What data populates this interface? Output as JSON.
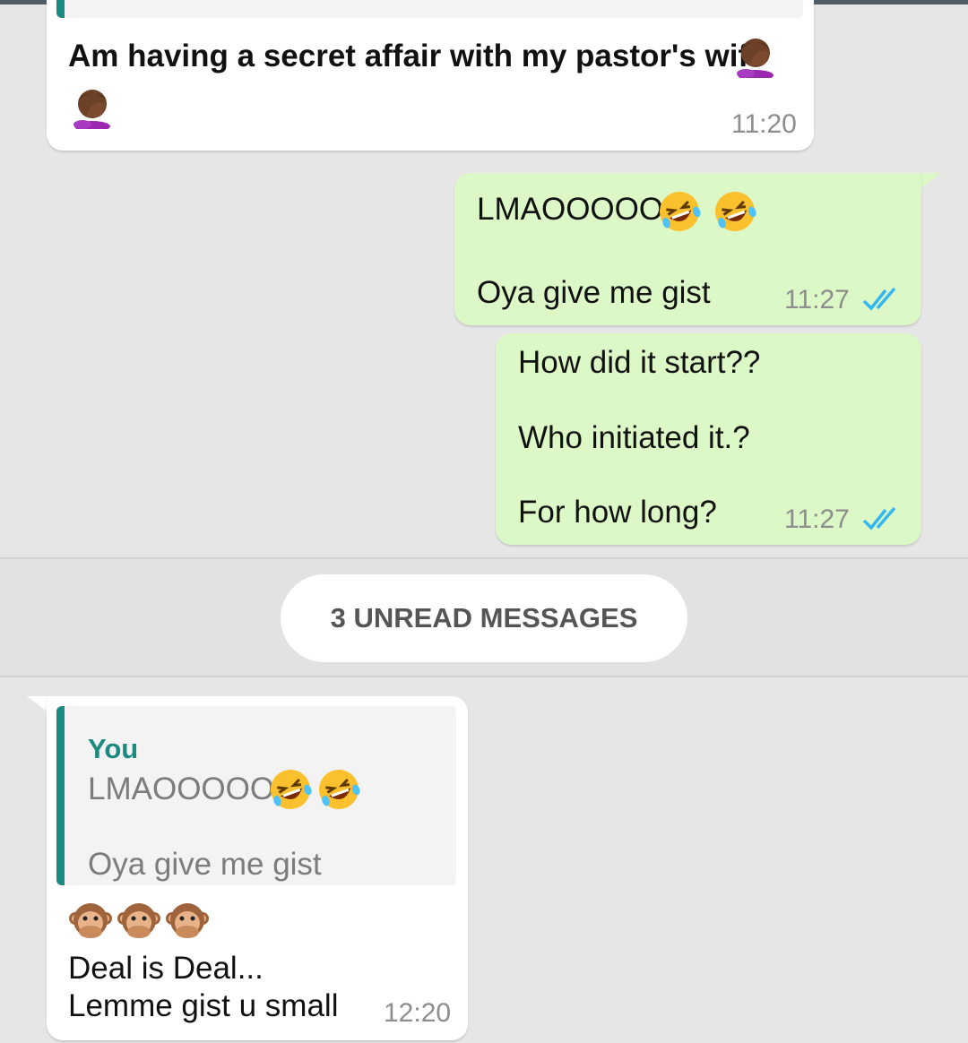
{
  "messages": [
    {
      "id": "m1",
      "direction": "incoming",
      "text": "Am having a secret affair with my pastor's wife",
      "time": "11:20"
    },
    {
      "id": "m2",
      "direction": "outgoing",
      "line1": "LMAOOOOO",
      "line2": "Oya give me gist",
      "time": "11:27",
      "status": "read"
    },
    {
      "id": "m3",
      "direction": "outgoing",
      "line1": "How did it start??",
      "line2": "Who initiated it.?",
      "line3": "For how long?",
      "time": "11:27",
      "status": "read"
    },
    {
      "id": "m4",
      "direction": "incoming",
      "quote": {
        "author": "You",
        "line1": "LMAOOOOO",
        "line2": "Oya give me gist"
      },
      "line1": "Deal is Deal...",
      "line2": "Lemme gist u small",
      "time": "12:20"
    }
  ],
  "unread_divider": "3 UNREAD MESSAGES",
  "icons": {
    "facepalm": "man-facepalming-emoji",
    "laughing": "rolling-on-floor-laughing-emoji",
    "monkey": "speak-no-evil-monkey-emoji",
    "read_ticks": "double-check-icon"
  },
  "colors": {
    "incoming_bubble": "#ffffff",
    "outgoing_bubble": "#dcf8c6",
    "quote_accent": "#1a8b7e",
    "read_ticks": "#34b7f1",
    "background": "#e6e6e6"
  }
}
